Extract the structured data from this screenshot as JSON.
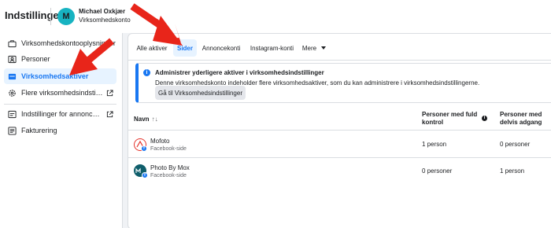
{
  "header": {
    "title": "Indstillinger",
    "avatar_initial": "M",
    "account_name": "Michael Oxkjær",
    "account_type": "Virksomhedskonto"
  },
  "sidebar": {
    "items": [
      {
        "label": "Virksomhedskontooplysninger",
        "icon": "briefcase-icon",
        "active": false,
        "external": false
      },
      {
        "label": "Personer",
        "icon": "people-icon",
        "active": false,
        "external": false
      },
      {
        "label": "Virksomhedsaktiver",
        "icon": "assets-icon",
        "active": true,
        "external": false
      },
      {
        "label": "Flere virksomhedsindstillinger",
        "icon": "gear-icon",
        "active": false,
        "external": true
      },
      {
        "label": "Indstillinger for annoncekonti",
        "icon": "ad-account-icon",
        "active": false,
        "external": true
      },
      {
        "label": "Fakturering",
        "icon": "billing-icon",
        "active": false,
        "external": false
      }
    ]
  },
  "tabs": [
    {
      "label": "Alle aktiver",
      "active": false
    },
    {
      "label": "Sider",
      "active": true
    },
    {
      "label": "Annoncekonti",
      "active": false
    },
    {
      "label": "Instagram-konti",
      "active": false
    },
    {
      "label": "Mere",
      "active": false
    }
  ],
  "notice": {
    "title": "Administrer yderligere aktiver i virksomhedsindstillinger",
    "body": "Denne virksomhedskonto indeholder flere virksomhedsaktiver, som du kan administrere i virksomhedsindstillingerne.",
    "button": "Gå til Virksomhedsindstillinger"
  },
  "table": {
    "columns": [
      "Navn",
      "Personer med fuld kontrol",
      "Personer med delvis adgang"
    ],
    "rows": [
      {
        "name": "Mofoto",
        "type": "Facebook-side",
        "full": "1 person",
        "partial": "0 personer"
      },
      {
        "name": "Photo By Mox",
        "type": "Facebook-side",
        "full": "0 personer",
        "partial": "1 person"
      }
    ]
  },
  "colors": {
    "accent": "#1877f2",
    "annotation_arrow": "#e8251a",
    "avatar_bg": "#17b3c1"
  }
}
